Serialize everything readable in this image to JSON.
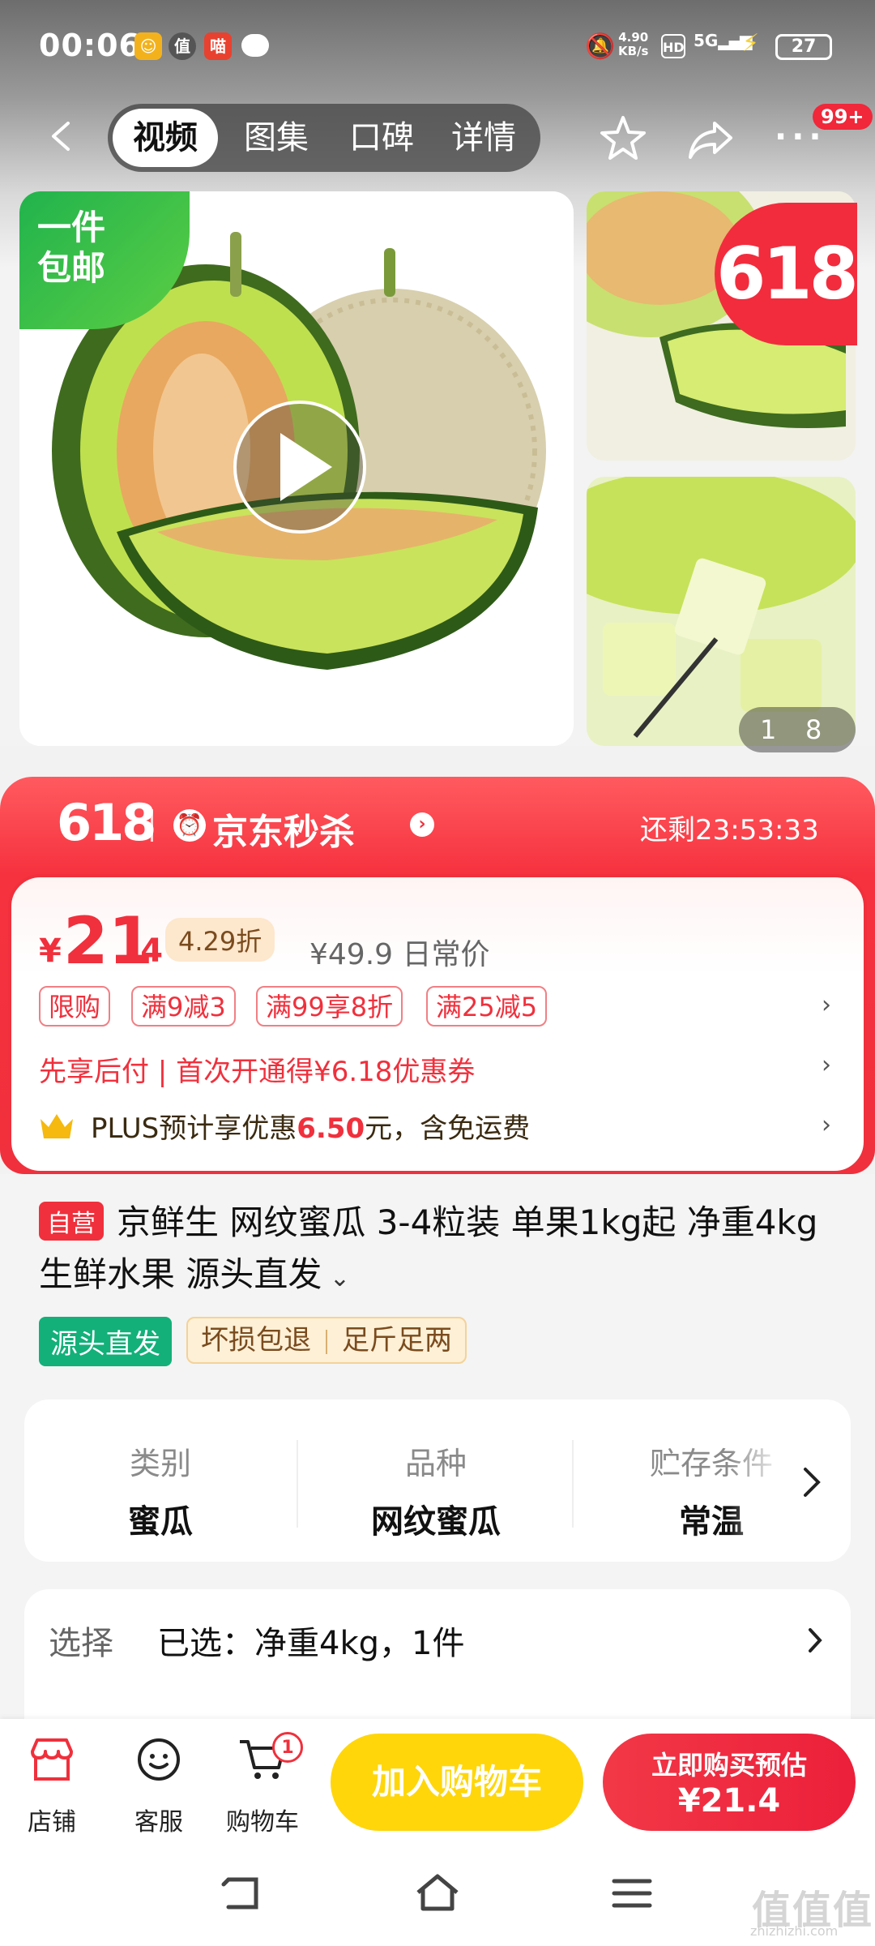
{
  "status_bar": {
    "time": "00:06",
    "speed_value": "4.90",
    "speed_unit": "KB/s",
    "network": "5G",
    "hd": "HD",
    "battery": "27"
  },
  "nav": {
    "tabs": [
      "视频",
      "图集",
      "口碑",
      "详情"
    ],
    "active_tab": "视频",
    "message_badge": "99+"
  },
  "gallery": {
    "free_shipping_line1": "一件",
    "free_shipping_line2": "包邮",
    "promo_badge": "618",
    "counter_current": "1",
    "counter_total": "8"
  },
  "flash_sale": {
    "event": "618",
    "title": "京东秒杀",
    "countdown": "还剩23:53:33"
  },
  "price": {
    "currency": "¥",
    "integer": "21",
    "decimal": ".4",
    "discount": "4.29折",
    "original": "¥49.9 日常价"
  },
  "coupons": [
    "限购",
    "满9减3",
    "满99享8折",
    "满25减5"
  ],
  "pay_later": "先享后付 | 首次开通得¥6.18优惠券",
  "plus": {
    "prefix": "PLUS预计享优惠",
    "amount": "6.50",
    "suffix": "元，含免运费"
  },
  "product": {
    "badge": "自营",
    "title": "京鲜生 网纹蜜瓜 3-4粒装 单果1kg起 净重4kg 生鲜水果 源头直发",
    "tag_green": "源头直发",
    "tags": [
      "坏损包退",
      "足斤足两"
    ]
  },
  "attributes": [
    {
      "key": "类别",
      "value": "蜜瓜"
    },
    {
      "key": "品种",
      "value": "网纹蜜瓜"
    },
    {
      "key": "贮存条件",
      "value": "常温"
    }
  ],
  "selection": {
    "label": "选择",
    "value": "已选：净重4kg，1件"
  },
  "bottom_bar": {
    "store": "店铺",
    "service": "客服",
    "cart": "购物车",
    "cart_count": "1",
    "add_to_cart": "加入购物车",
    "buy_now_line1": "立即购买预估",
    "buy_now_line2": "¥21.4"
  },
  "watermark": {
    "text": "值值值",
    "url": "zhizhizhi.com"
  },
  "colors": {
    "accent_red": "#f0303c",
    "cart_yellow": "#ffd60a",
    "green_tag": "#13b07a"
  }
}
